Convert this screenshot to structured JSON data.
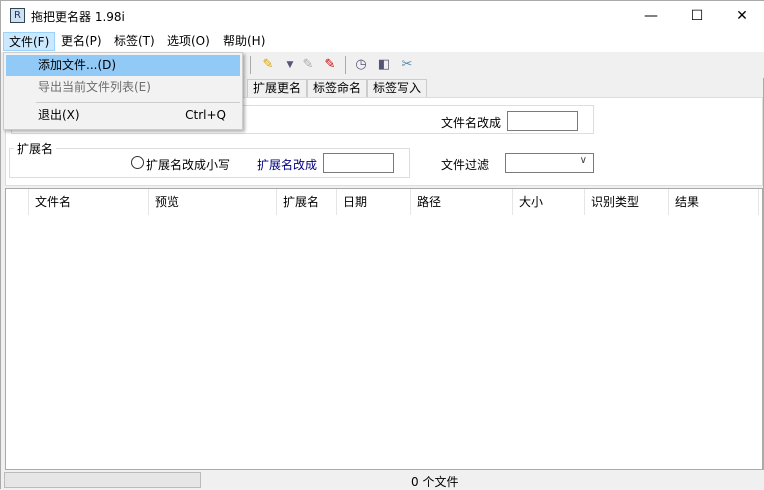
{
  "window": {
    "title": "拖把更名器 1.98i",
    "icon": "app-icon",
    "minimize": "—",
    "maximize": "☐",
    "close": "✕"
  },
  "menu": [
    "文件(F)",
    "更名(P)",
    "标签(T)",
    "选项(O)",
    "帮助(H)"
  ],
  "file_menu": {
    "add": "添加文件...(D)",
    "export": "导出当前文件列表(E)",
    "exit": "退出(X)",
    "exit_shortcut": "Ctrl+Q"
  },
  "tabs": [
    "扩展更名",
    "标签命名",
    "标签写入"
  ],
  "panel": {
    "rename_to_label": "文件名改成",
    "rename_to_value": "",
    "ext_group": "扩展名",
    "ext_lower": "扩展名改成小写",
    "ext_rename_label": "扩展名改成",
    "ext_rename_value": "",
    "filter_label": "文件过滤",
    "filter_value": ""
  },
  "columns": [
    "文件名",
    "预览",
    "扩展名",
    "日期",
    "路径",
    "大小",
    "识别类型",
    "结果"
  ],
  "status": {
    "count": "0 个文件"
  },
  "colors": {
    "highlight": "#91c9f7",
    "link_blue": "#000080"
  }
}
